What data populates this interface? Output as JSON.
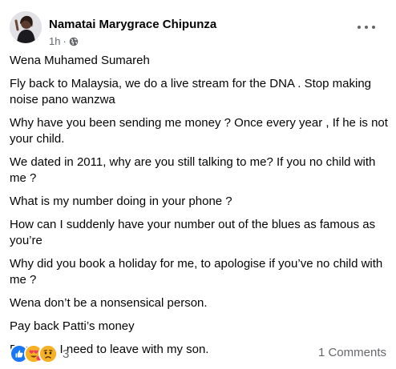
{
  "post": {
    "author": "Namatai Marygrace Chipunza",
    "time": "1h",
    "time_separator": "·",
    "privacy_icon": "globe-icon",
    "paragraphs": [
      "Wena Muhamed Sumareh",
      "Fly back to Malaysia, we do a live stream for the DNA . Stop making noise pano wanzwa",
      "Why have you been sending me money ? Once every year , If he is not your child.",
      "We dated in 2011, why are you still talking to me? If you no child with me ?",
      "What is my number doing in your phone ?",
      "How can I suddenly have your number out of the blues as famous as you’re",
      "Why did you book a holiday for me, to apologise if you’ve no child with me ?",
      "Wena don’t be a nonsensical person.",
      "Pay back Patti’s money",
      "Because I need to leave with my son."
    ]
  },
  "footer": {
    "reaction_count": "3",
    "comments_label": "1 Comments",
    "reaction_icons": [
      "like-icon",
      "love-icon",
      "sad-icon"
    ]
  },
  "colors": {
    "like": "#1877f2",
    "love": "#f33e58",
    "sad": "#f7b125",
    "secondary_text": "#65676b"
  }
}
